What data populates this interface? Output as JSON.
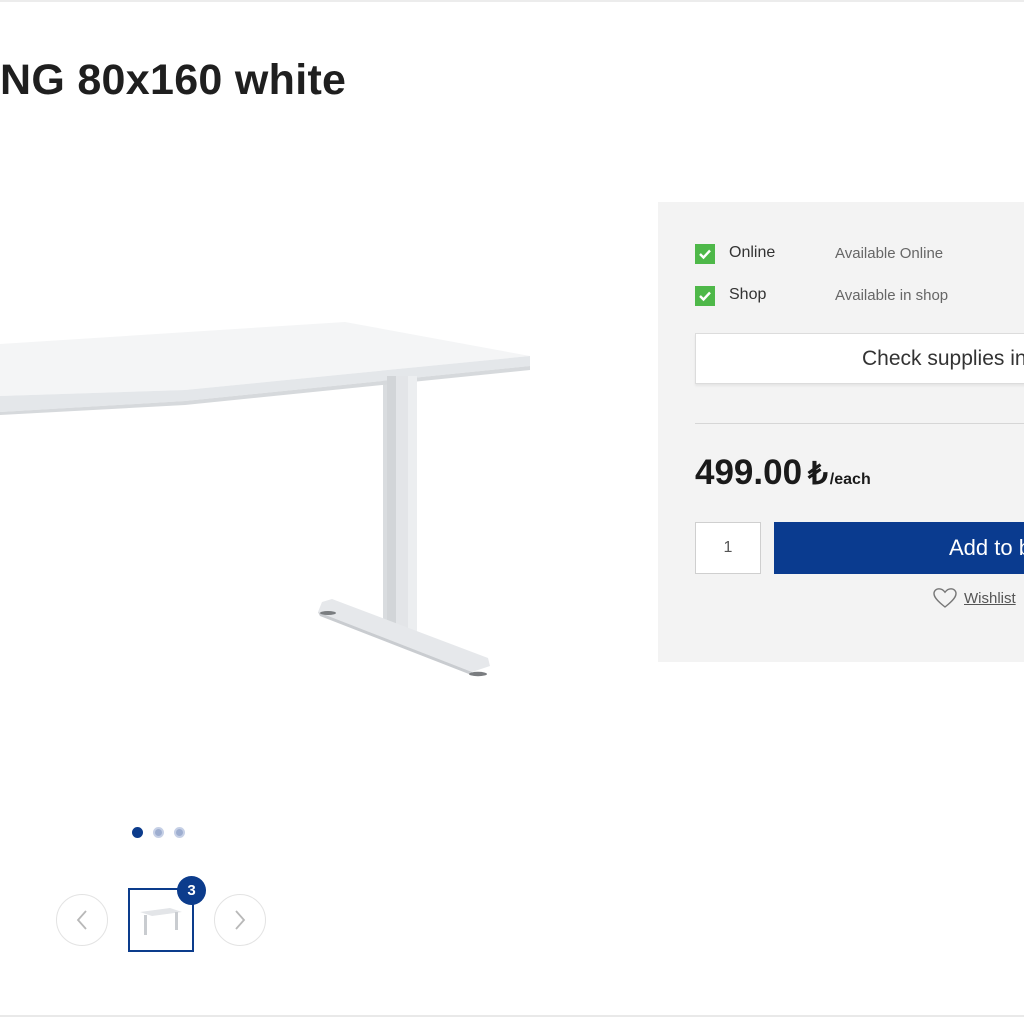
{
  "product": {
    "title": "NG 80x160 white",
    "image_icon": "desk-image"
  },
  "gallery": {
    "dot_count": 3,
    "active_dot": 1,
    "prev_icon": "chevron-left-icon",
    "next_icon": "chevron-right-icon",
    "thumbnail_count": "3"
  },
  "availability": [
    {
      "label": "Online",
      "status": "Available Online",
      "checked": true
    },
    {
      "label": "Shop",
      "status": "Available in shop",
      "checked": true
    }
  ],
  "supplies_button": "Check supplies in",
  "price": {
    "amount": "499.00",
    "currency": "₺",
    "unit": "/each"
  },
  "cart": {
    "quantity": "1",
    "add_label": "Add to b"
  },
  "wishlist": {
    "icon": "heart-icon",
    "label": "Wishlist"
  },
  "colors": {
    "brand_blue": "#0a3b8f",
    "check_green": "#4eb849",
    "panel_bg": "#f3f3f3"
  }
}
